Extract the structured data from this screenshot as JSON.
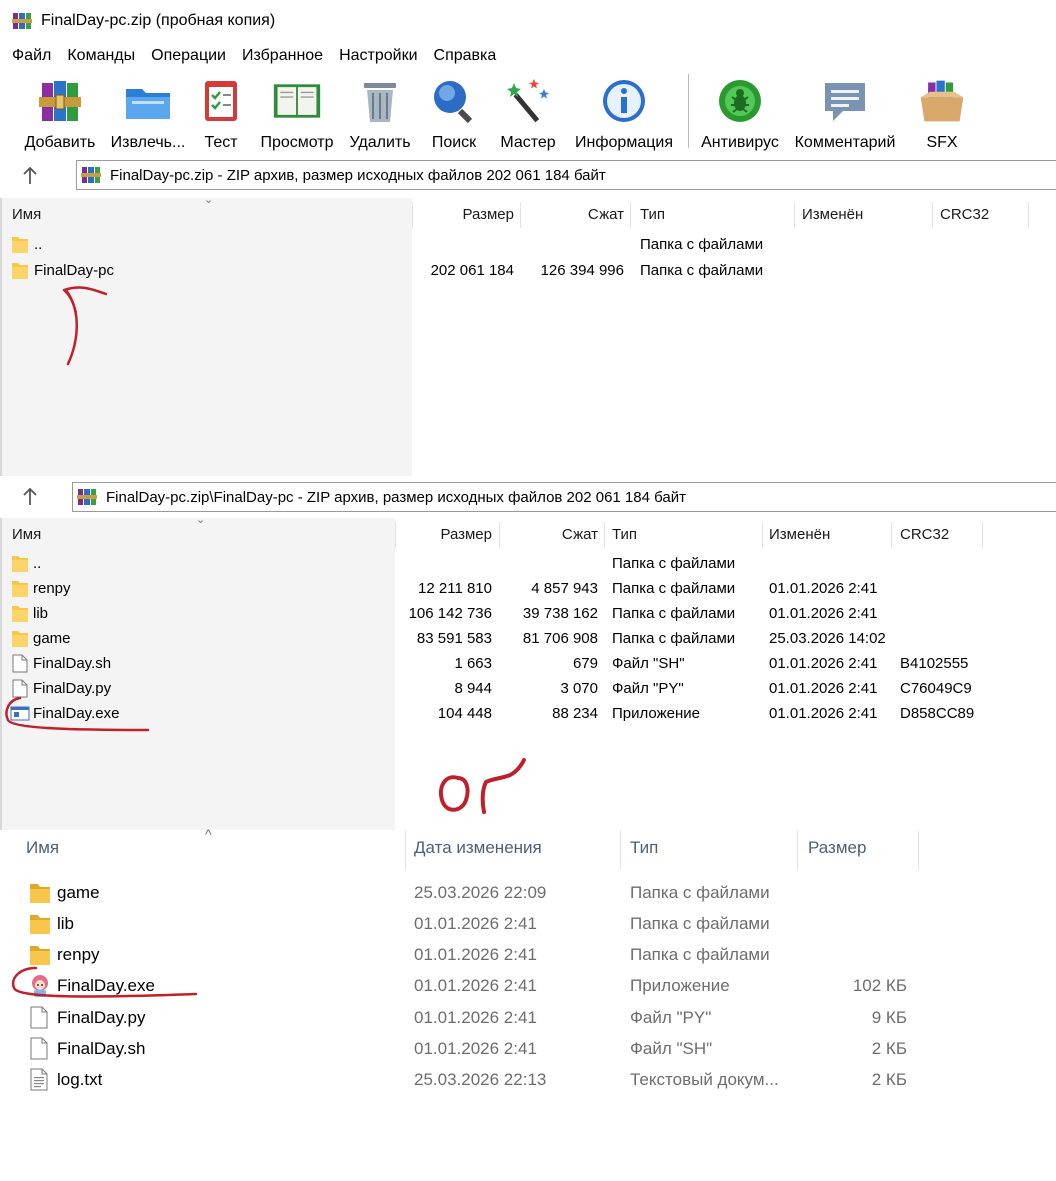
{
  "window": {
    "title": "FinalDay-pc.zip (пробная копия)"
  },
  "menu": [
    "Файл",
    "Команды",
    "Операции",
    "Избранное",
    "Настройки",
    "Справка"
  ],
  "toolbar": [
    {
      "label": "Добавить",
      "icon": "add-books-icon"
    },
    {
      "label": "Извлечь...",
      "icon": "extract-folder-icon"
    },
    {
      "label": "Тест",
      "icon": "test-clipboard-icon"
    },
    {
      "label": "Просмотр",
      "icon": "view-book-icon"
    },
    {
      "label": "Удалить",
      "icon": "trash-icon"
    },
    {
      "label": "Поиск",
      "icon": "search-icon"
    },
    {
      "label": "Мастер",
      "icon": "wizard-icon"
    },
    {
      "label": "Информация",
      "icon": "info-icon"
    },
    {
      "label": "Антивирус",
      "icon": "antivirus-icon"
    },
    {
      "label": "Комментарий",
      "icon": "comment-icon"
    },
    {
      "label": "SFX",
      "icon": "sfx-icon"
    }
  ],
  "pane1": {
    "address": "FinalDay-pc.zip - ZIP архив, размер исходных файлов 202 061 184 байт",
    "headers": {
      "name": "Имя",
      "size": "Размер",
      "packed": "Сжат",
      "type": "Тип",
      "modified": "Изменён",
      "crc": "CRC32"
    },
    "rows": [
      {
        "name": "..",
        "size": "",
        "packed": "",
        "type": "Папка с файлами",
        "modified": "",
        "crc": "",
        "kind": "folder"
      },
      {
        "name": "FinalDay-pc",
        "size": "202 061 184",
        "packed": "126 394 996",
        "type": "Папка с файлами",
        "modified": "",
        "crc": "",
        "kind": "folder"
      }
    ]
  },
  "pane2": {
    "address": "FinalDay-pc.zip\\FinalDay-pc - ZIP архив, размер исходных файлов 202 061 184 байт",
    "headers": {
      "name": "Имя",
      "size": "Размер",
      "packed": "Сжат",
      "type": "Тип",
      "modified": "Изменён",
      "crc": "CRC32"
    },
    "rows": [
      {
        "name": "..",
        "size": "",
        "packed": "",
        "type": "Папка с файлами",
        "modified": "",
        "crc": "",
        "kind": "folder"
      },
      {
        "name": "renpy",
        "size": "12 211 810",
        "packed": "4 857 943",
        "type": "Папка с файлами",
        "modified": "01.01.2026 2:41",
        "crc": "",
        "kind": "folder"
      },
      {
        "name": "lib",
        "size": "106 142 736",
        "packed": "39 738 162",
        "type": "Папка с файлами",
        "modified": "01.01.2026 2:41",
        "crc": "",
        "kind": "folder"
      },
      {
        "name": "game",
        "size": "83 591 583",
        "packed": "81 706 908",
        "type": "Папка с файлами",
        "modified": "25.03.2026 14:02",
        "crc": "",
        "kind": "folder"
      },
      {
        "name": "FinalDay.sh",
        "size": "1 663",
        "packed": "679",
        "type": "Файл \"SH\"",
        "modified": "01.01.2026 2:41",
        "crc": "B4102555",
        "kind": "file"
      },
      {
        "name": "FinalDay.py",
        "size": "8 944",
        "packed": "3 070",
        "type": "Файл \"PY\"",
        "modified": "01.01.2026 2:41",
        "crc": "C76049C9",
        "kind": "file"
      },
      {
        "name": "FinalDay.exe",
        "size": "104 448",
        "packed": "88 234",
        "type": "Приложение",
        "modified": "01.01.2026 2:41",
        "crc": "D858CC89",
        "kind": "exe"
      }
    ]
  },
  "explorer": {
    "headers": {
      "name": "Имя",
      "modified": "Дата изменения",
      "type": "Тип",
      "size": "Размер"
    },
    "rows": [
      {
        "name": "game",
        "modified": "25.03.2026 22:09",
        "type": "Папка с файлами",
        "size": "",
        "kind": "folder"
      },
      {
        "name": "lib",
        "modified": "01.01.2026 2:41",
        "type": "Папка с файлами",
        "size": "",
        "kind": "folder"
      },
      {
        "name": "renpy",
        "modified": "01.01.2026 2:41",
        "type": "Папка с файлами",
        "size": "",
        "kind": "folder"
      },
      {
        "name": "FinalDay.exe",
        "modified": "01.01.2026 2:41",
        "type": "Приложение",
        "size": "102 КБ",
        "kind": "app"
      },
      {
        "name": "FinalDay.py",
        "modified": "01.01.2026 2:41",
        "type": "Файл \"PY\"",
        "size": "9 КБ",
        "kind": "file"
      },
      {
        "name": "FinalDay.sh",
        "modified": "01.01.2026 2:41",
        "type": "Файл \"SH\"",
        "size": "2 КБ",
        "kind": "file"
      },
      {
        "name": "log.txt",
        "modified": "25.03.2026 22:13",
        "type": "Текстовый докум...",
        "size": "2 КБ",
        "kind": "text"
      }
    ]
  },
  "annotation": {
    "handwritten_text": "ОГ",
    "color": "#c0202a"
  },
  "colors": {
    "folder": "#f8c64a",
    "folder_dark": "#e0a72a",
    "annotation_red": "#c0202a",
    "header_text_explorer": "#4c607a"
  }
}
